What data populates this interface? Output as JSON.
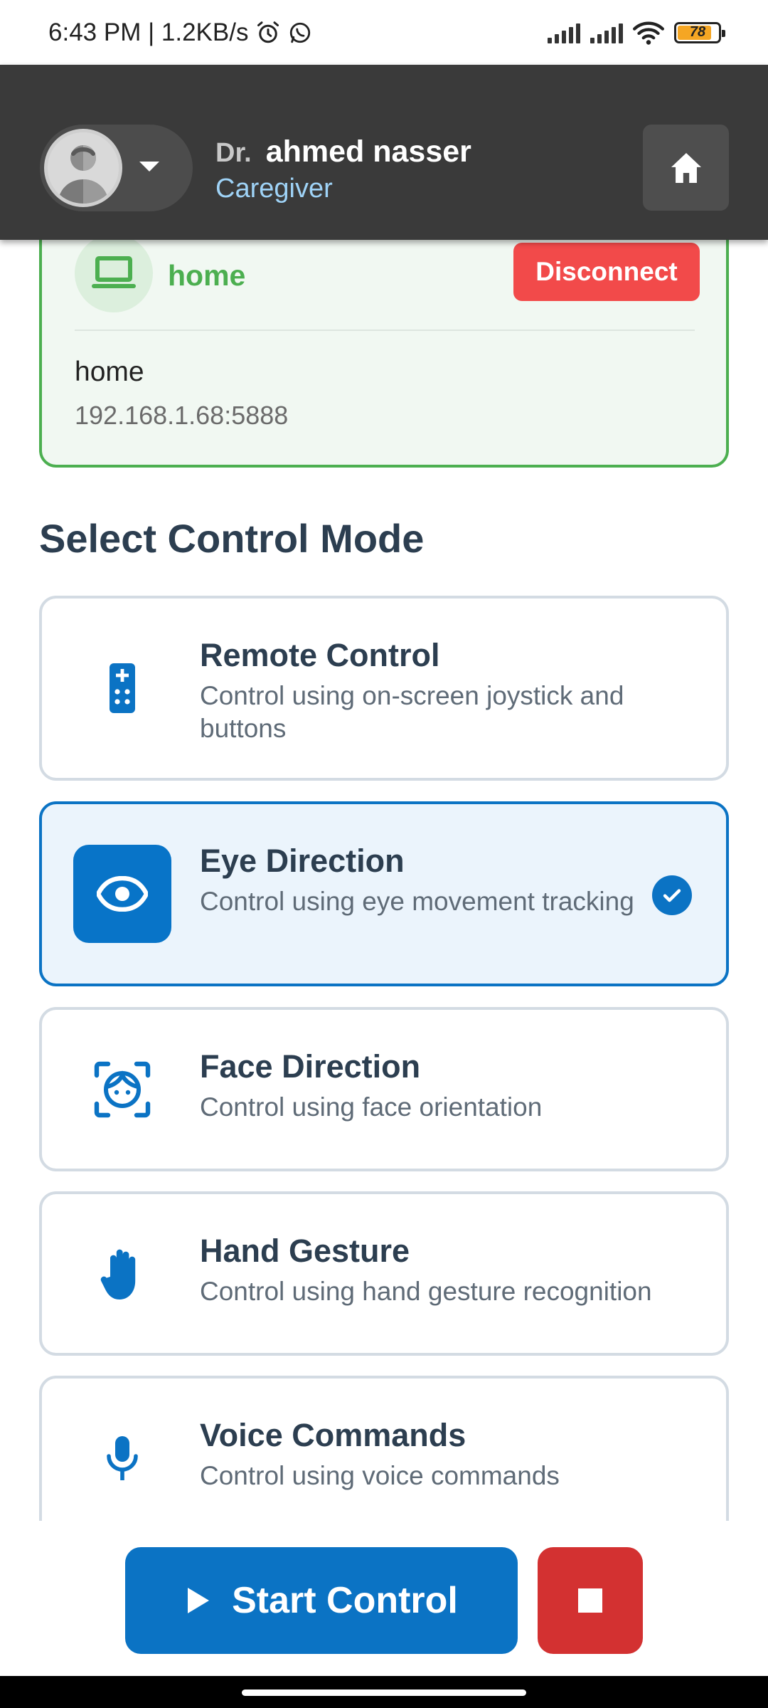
{
  "status_bar": {
    "time_speed": "6:43 PM | 1.2KB/s",
    "battery": "78",
    "icons": [
      "alarm-icon",
      "whatsapp-icon",
      "signal-icon",
      "signal-icon",
      "wifi-icon",
      "battery-icon"
    ]
  },
  "header": {
    "title_prefix": "Dr.",
    "user_name": "ahmed nasser",
    "role": "Caregiver",
    "home_icon": "home-icon"
  },
  "device": {
    "name": "home",
    "disconnect_label": "Disconnect",
    "label": "home",
    "address": "192.168.1.68:5888",
    "icon": "laptop-icon"
  },
  "section_title": "Select Control Mode",
  "modes": [
    {
      "title": "Remote Control",
      "desc": "Control using on-screen joystick and buttons",
      "icon": "remote-icon",
      "selected": false
    },
    {
      "title": "Eye Direction",
      "desc": "Control using eye movement tracking",
      "icon": "eye-icon",
      "selected": true
    },
    {
      "title": "Face Direction",
      "desc": "Control using face orientation",
      "icon": "face-icon",
      "selected": false
    },
    {
      "title": "Hand Gesture",
      "desc": "Control using hand gesture recognition",
      "icon": "hand-icon",
      "selected": false
    },
    {
      "title": "Voice Commands",
      "desc": "Control using voice commands",
      "icon": "microphone-icon",
      "selected": false
    }
  ],
  "actions": {
    "start_label": "Start Control",
    "start_icon": "play-icon",
    "stop_icon": "stop-icon"
  },
  "colors": {
    "primary": "#0b73c4",
    "connected": "#4caf50",
    "danger": "#f24a4a",
    "stop": "#d33131",
    "header_bg": "#3a3a3a"
  }
}
